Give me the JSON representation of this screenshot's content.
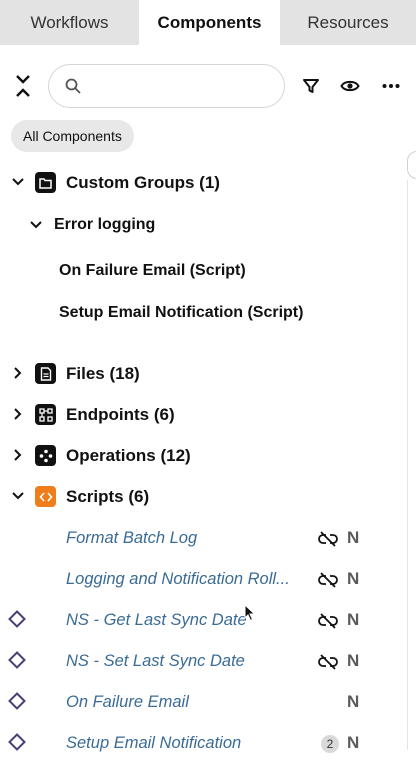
{
  "tabs": [
    {
      "label": "Workflows"
    },
    {
      "label": "Components"
    },
    {
      "label": "Resources"
    }
  ],
  "toolbar": {
    "search_value": "",
    "search_placeholder": "",
    "icons": [
      "collapse-all-icon",
      "filter-icon",
      "eye-icon",
      "more-icon"
    ]
  },
  "filter_chip": {
    "label": "All Components"
  },
  "tree": {
    "custom_groups": {
      "label": "Custom Groups (1)",
      "expanded": true,
      "icon": "folder-icon"
    },
    "error_logging": {
      "label": "Error logging",
      "expanded": true
    },
    "error_logging_items": [
      {
        "label": "On Failure Email (Script)"
      },
      {
        "label": "Setup Email Notification (Script)"
      }
    ],
    "files": {
      "label": "Files (18)",
      "expanded": false,
      "icon": "file-icon"
    },
    "endpoints": {
      "label": "Endpoints (6)",
      "expanded": false,
      "icon": "endpoint-icon"
    },
    "operations": {
      "label": "Operations (12)",
      "expanded": false,
      "icon": "operation-icon"
    },
    "scripts": {
      "label": "Scripts (6)",
      "expanded": true,
      "icon": "script-icon"
    },
    "script_items": [
      {
        "label": "Format Batch Log",
        "unlinked": true,
        "mark": "N"
      },
      {
        "label": "Logging and Notification Roll...",
        "unlinked": true,
        "mark": "N"
      },
      {
        "label": "NS - Get Last Sync Date",
        "unlinked": true,
        "mark": "N",
        "diamond": true
      },
      {
        "label": "NS - Set Last Sync Date",
        "unlinked": true,
        "mark": "N",
        "diamond": true
      },
      {
        "label": "On Failure Email",
        "unlinked": false,
        "mark": "N",
        "diamond": true
      },
      {
        "label": "Setup Email Notification",
        "unlinked": false,
        "mark": "N",
        "diamond": true,
        "badge": "2"
      }
    ]
  },
  "colors": {
    "tab_bar": "#e3e3e3",
    "link_text": "#3a6b95",
    "script_icon": "#ef7d1a",
    "diamond": "#4a3f78"
  }
}
